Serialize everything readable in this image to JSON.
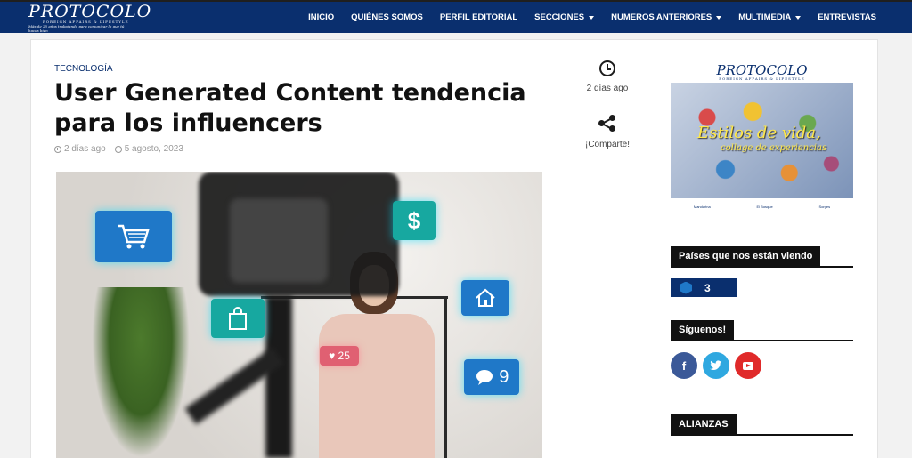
{
  "header": {
    "logo_word": "PROTOCOLO",
    "logo_sub": "FOREIGN AFFAIRS & LIFESTYLE",
    "logo_tag": "Más de 25 años trabajando para comunicar lo que tú haces bien",
    "nav": [
      {
        "label": "INICIO",
        "dropdown": false
      },
      {
        "label": "QUIÉNES SOMOS",
        "dropdown": false
      },
      {
        "label": "PERFIL EDITORIAL",
        "dropdown": false
      },
      {
        "label": "SECCIONES",
        "dropdown": true
      },
      {
        "label": "NUMEROS ANTERIORES",
        "dropdown": true
      },
      {
        "label": "MULTIMEDIA",
        "dropdown": true
      },
      {
        "label": "ENTREVISTAS",
        "dropdown": false
      }
    ]
  },
  "article": {
    "category": "TECNOLOGÍA",
    "title": "User Generated Content tendencia para los influencers",
    "ago": "2 días ago",
    "date": "5 agosto, 2023",
    "image": {
      "like_count": "25",
      "chat_count": "9",
      "dollar": "$"
    }
  },
  "share": {
    "time_text": "2 días ago",
    "share_text": "¡Comparte!"
  },
  "sidebar": {
    "ad": {
      "brand": "PROTOCOLO",
      "brand_sub": "FOREIGN AFFAIRS & LIFESTYLE",
      "headline": "Estilos de vida,",
      "subhead": "collage de experiencias",
      "footer": [
        "Mandarina",
        "El Bosque",
        "Sorges"
      ]
    },
    "paises_title": "Países que nos están viendo",
    "paises_count": "3",
    "siguenos_title": "Síguenos!",
    "socials": [
      "f",
      "t",
      "youtube"
    ],
    "alianzas_title": "ALIANZAS"
  },
  "colors": {
    "nav_bg": "#0a2f6e",
    "facebook": "#3b5998",
    "twitter": "#2fa8e0",
    "youtube": "#e02a2a"
  }
}
